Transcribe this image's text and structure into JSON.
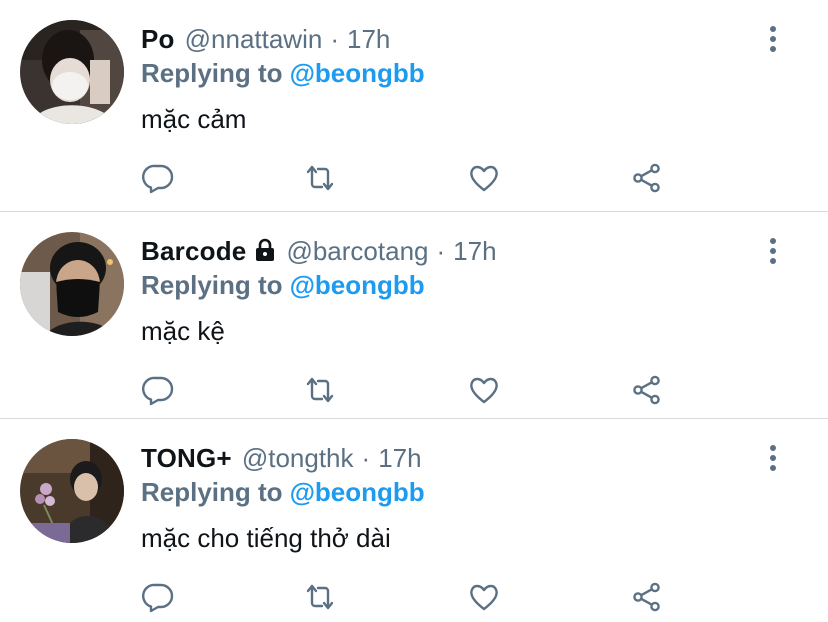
{
  "colors": {
    "text_primary": "#0f1419",
    "text_secondary": "#5b7083",
    "accent": "#1d9bf0",
    "divider": "#d6dbdf"
  },
  "tweets": [
    {
      "display_name": "Po",
      "protected": false,
      "handle": "@nnattawin",
      "separator": "·",
      "time": "17h",
      "reply_prefix": "Replying to",
      "reply_target": "@beongbb",
      "text": "mặc cảm"
    },
    {
      "display_name": "Barcode",
      "protected": true,
      "lock_icon": "lock-icon",
      "handle": "@barcotang",
      "separator": "·",
      "time": "17h",
      "reply_prefix": "Replying to",
      "reply_target": "@beongbb",
      "text": "mặc kệ"
    },
    {
      "display_name": "TONG+",
      "protected": false,
      "handle": "@tongthk",
      "separator": "·",
      "time": "17h",
      "reply_prefix": "Replying to",
      "reply_target": "@beongbb",
      "text": "mặc cho tiếng thở dài"
    }
  ],
  "actions": {
    "icons": [
      "reply-icon",
      "retweet-icon",
      "like-icon",
      "share-icon"
    ]
  },
  "menu_icon": "more-options-icon"
}
